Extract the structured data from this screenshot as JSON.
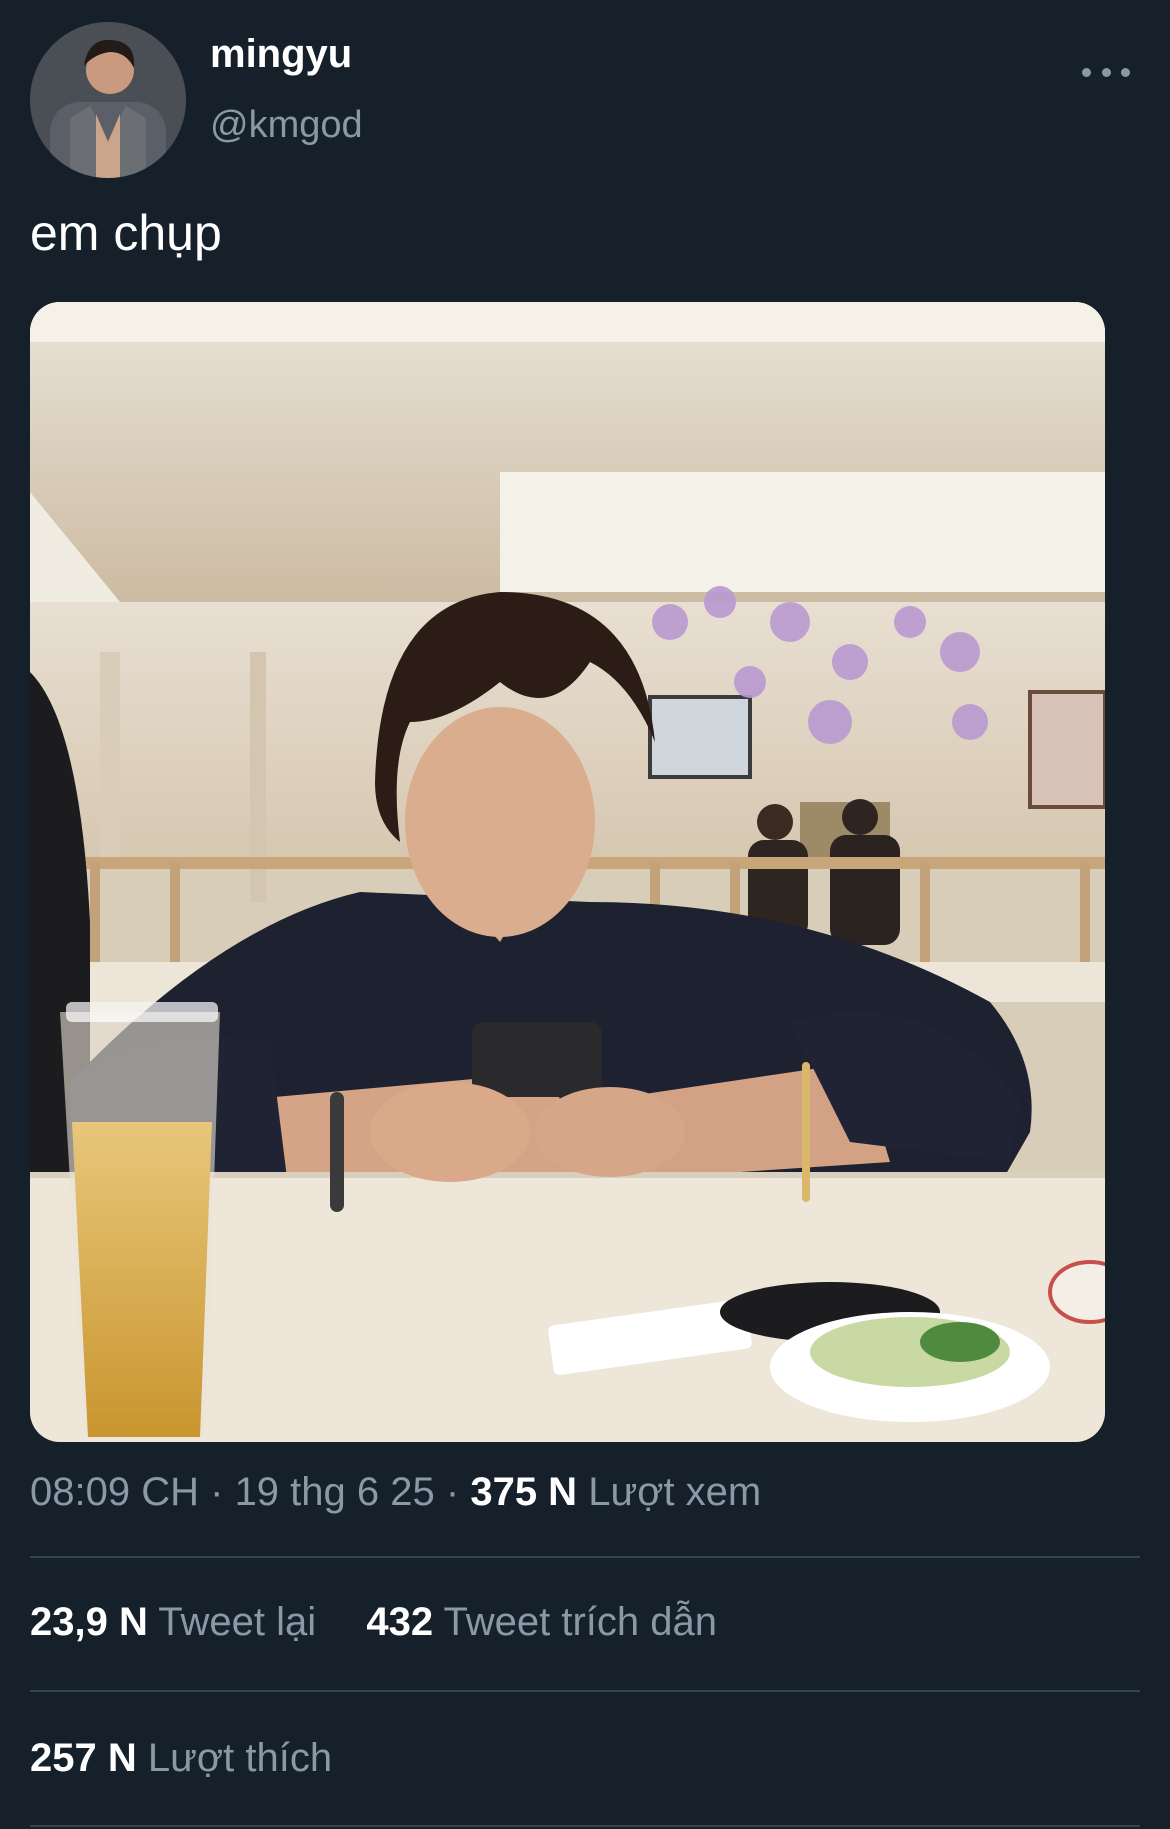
{
  "tweet": {
    "author": {
      "display_name": "mingyu",
      "handle": "@kmgod",
      "avatar": "profile-photo"
    },
    "more_icon": "more-horizontal-icon",
    "text": "em chụp",
    "media": "photo-man-looking-at-phone-restaurant",
    "meta": {
      "time": "08:09 CH",
      "separator": "·",
      "date": "19 thg 6 25",
      "views_count": "375 N",
      "views_label": "Lượt xem"
    },
    "stats": {
      "retweets_count": "23,9 N",
      "retweets_label": "Tweet lại",
      "quotes_count": "432",
      "quotes_label": "Tweet trích dẫn",
      "likes_count": "257 N",
      "likes_label": "Lượt thích"
    }
  },
  "colors": {
    "background": "#15202b",
    "primary_text": "#ffffff",
    "secondary_text": "#8b98a5",
    "divider": "#38444d"
  }
}
